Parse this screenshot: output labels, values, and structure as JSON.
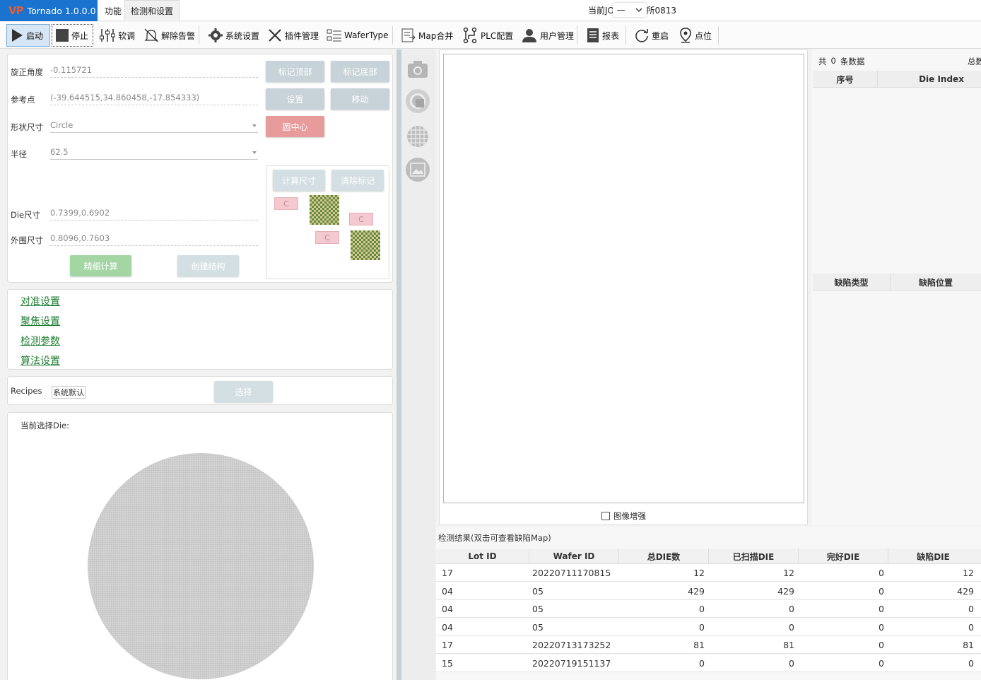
{
  "app": {
    "title": "Tornado 1.0.0.0",
    "logo": "VP",
    "brand_color": "#1a73cf"
  },
  "menu": {
    "tabs": [
      "功能",
      "检测和设置"
    ]
  },
  "job": {
    "prefix": "当前JOI",
    "suffix": "所0813"
  },
  "toolbar": {
    "start": "启动",
    "stop": "停止",
    "soft": "软调",
    "clear_alarm": "解除告警",
    "system": "系统设置",
    "plugin": "插件管理",
    "wafertype": "WaferType",
    "mapmerge": "Map合并",
    "plc": "PLC配置",
    "user": "用户管理",
    "report": "报表",
    "restart": "重启",
    "point": "点位"
  },
  "align_panel": {
    "rotation_label": "旋正角度",
    "rotation_value": "-0.115721",
    "ref_label": "参考点",
    "ref_value": "(-39.644515,34.860458,-17.854333)",
    "shape_label": "形状尺寸",
    "shape_value": "Circle",
    "radius_label": "半径",
    "radius_value": "62.5",
    "die_label": "Die尺寸",
    "die_value": "0.7399,0.6902",
    "outer_label": "外围尺寸",
    "outer_value": "0.8096,0.7603",
    "btn_mark_top": "标记顶部",
    "btn_mark_bottom": "标记底部",
    "btn_set": "设置",
    "btn_move": "移动",
    "btn_center": "圆中心",
    "btn_calc_size": "计算尺寸",
    "btn_clear_mark": "清除标记",
    "btn_fine_calc": "精细计算",
    "btn_create": "创建结构",
    "mark_letter": "C"
  },
  "settings_links": [
    "对准设置",
    "聚焦设置",
    "检测参数",
    "算法设置"
  ],
  "recipes": {
    "label": "Recipes",
    "value": "系统默认",
    "select_btn": "选择"
  },
  "die_panel": {
    "label": "当前选择Die:"
  },
  "image_panel": {
    "enhance_label": "图像增强"
  },
  "right_panel": {
    "count_prefix": "共",
    "count": "0",
    "count_suffix": "条数据",
    "total_label": "总数",
    "col_index": "序号",
    "col_die_index": "Die Index",
    "col_defect_type": "缺陷类型",
    "col_defect_pos": "缺陷位置"
  },
  "results": {
    "title": "检测结果(双击可查看缺陷Map)",
    "columns": [
      "Lot ID",
      "Wafer ID",
      "总DIE数",
      "已扫描DIE",
      "完好DIE",
      "缺陷DIE"
    ],
    "rows": [
      [
        "17",
        "20220711170815",
        "12",
        "12",
        "0",
        "12"
      ],
      [
        "04",
        "05",
        "429",
        "429",
        "0",
        "429"
      ],
      [
        "04",
        "05",
        "0",
        "0",
        "0",
        "0"
      ],
      [
        "04",
        "05",
        "0",
        "0",
        "0",
        "0"
      ],
      [
        "17",
        "20220713173252",
        "81",
        "81",
        "0",
        "81"
      ],
      [
        "15",
        "20220719151137",
        "0",
        "0",
        "0",
        "0"
      ]
    ]
  }
}
